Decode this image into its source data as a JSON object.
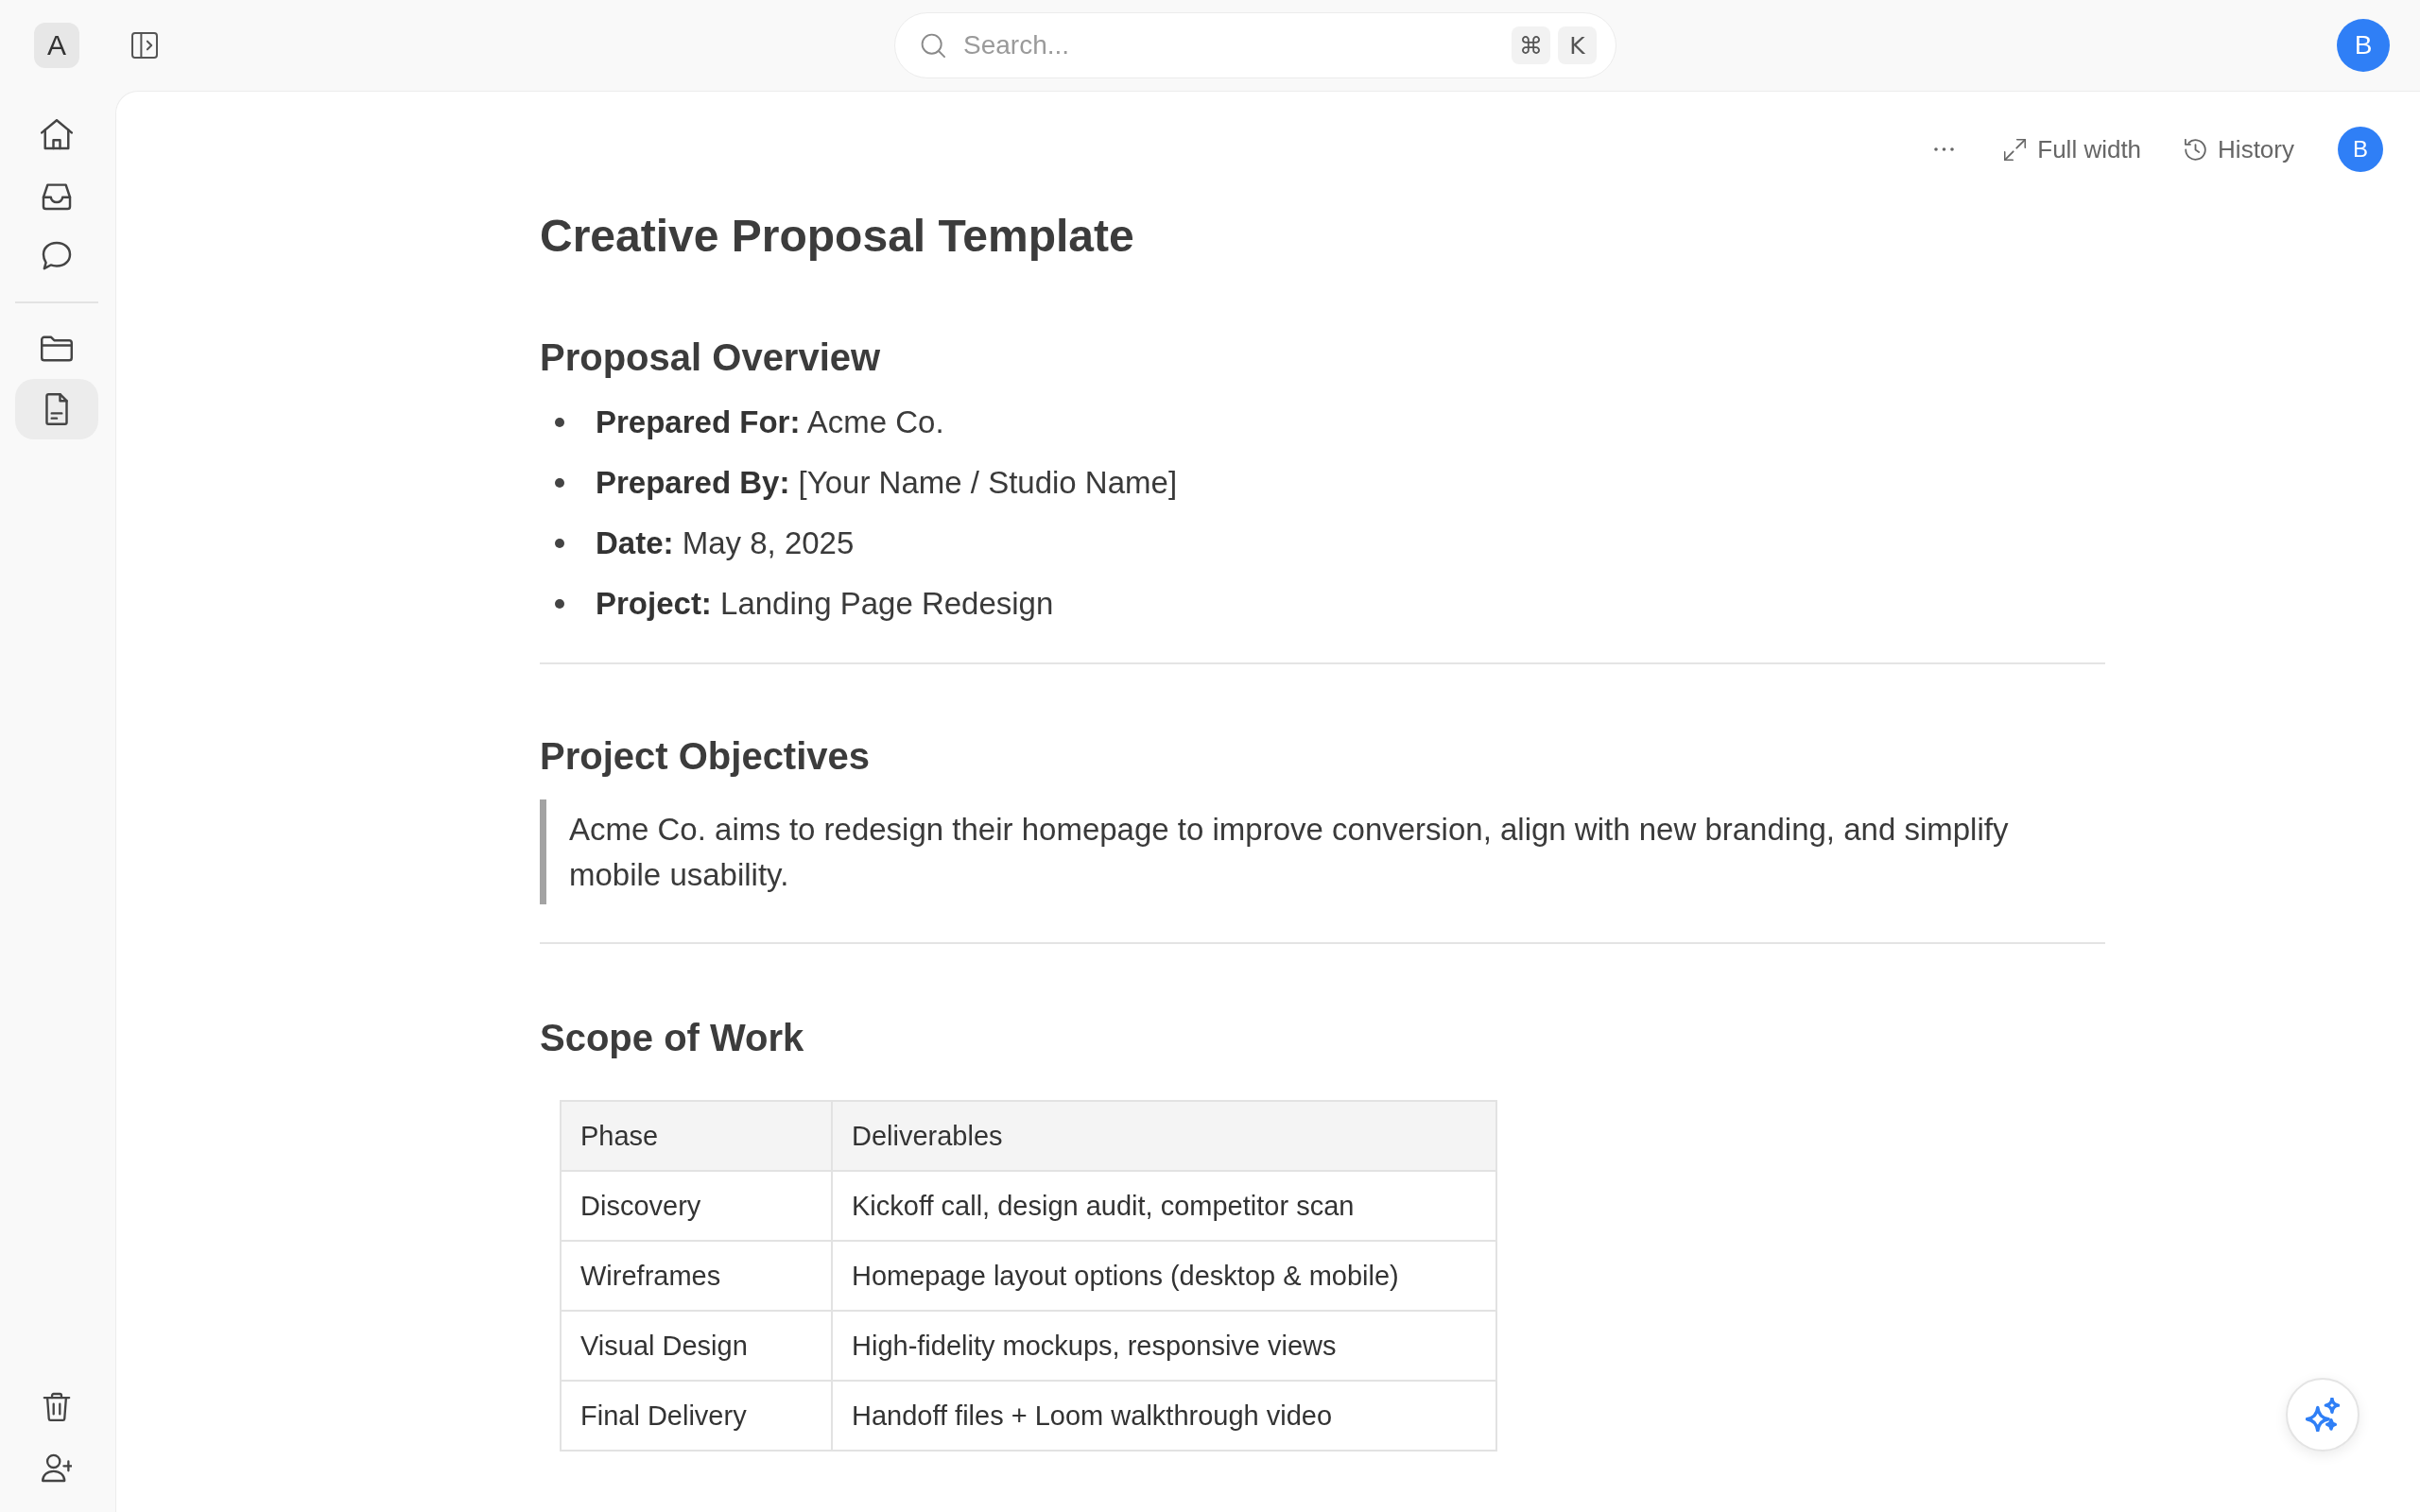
{
  "top_bar": {
    "workspace": {
      "initial": "A"
    },
    "search": {
      "placeholder": "Search...",
      "shortcut_keys": [
        "⌘",
        "K"
      ]
    },
    "account": {
      "initial": "B"
    }
  },
  "sidebar": {
    "nav_items": [
      {
        "selected": false
      },
      {
        "selected": false
      },
      {
        "selected": false
      }
    ],
    "page_items": [
      {
        "selected": false
      },
      {
        "selected": true
      }
    ]
  },
  "document_toolbar": {
    "buttons": [
      "Full width",
      "History"
    ],
    "avatar_initial": "B"
  },
  "document": {
    "title": "Creative Proposal Template",
    "sections": [
      {
        "heading": "Proposal Overview",
        "kind": "list",
        "items": [
          "**Prepared For:** Acme Co.",
          "**Prepared By:** [Your Name / Studio Name]",
          "**Date:** May 8, 2025",
          "**Project:** Landing Page Redesign"
        ]
      },
      {
        "heading": "Project Objectives",
        "kind": "quote",
        "text": "Acme Co. aims to redesign their homepage to improve conversion, align with new branding, and simplify mobile usability."
      },
      {
        "heading": "Scope of Work",
        "kind": "table",
        "columns": [
          "Phase",
          "Deliverables"
        ],
        "rows": [
          [
            "Discovery",
            "Kickoff call, design audit, competitor scan"
          ],
          [
            "Wireframes",
            "Homepage layout options (desktop & mobile)"
          ],
          [
            "Visual Design",
            "High-fidelity mockups, responsive views"
          ],
          [
            "Final Delivery",
            "Handoff files + Loom walkthrough video"
          ]
        ]
      }
    ]
  }
}
